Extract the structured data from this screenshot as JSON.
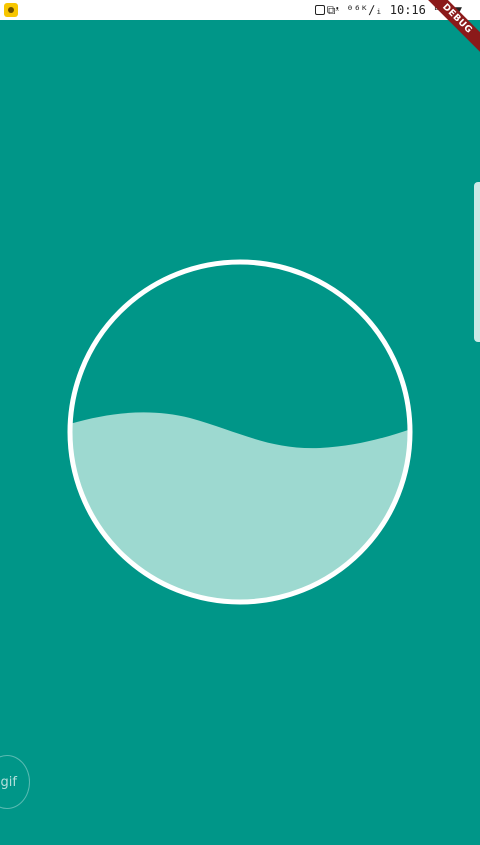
{
  "status_bar": {
    "right_text": "⧉ᵜ ⁰⁶ᴷ∕ᵢ 10:16 ᴮᵀ ▼",
    "app_icon": "app-notification-icon"
  },
  "debug_banner": {
    "label": "DEBUG"
  },
  "wave": {
    "fill_level": 0.5,
    "colors": {
      "background": "#009688",
      "wave": "#9dd9d0",
      "ring": "#ffffff"
    }
  },
  "gif_button": {
    "label": "gif"
  }
}
